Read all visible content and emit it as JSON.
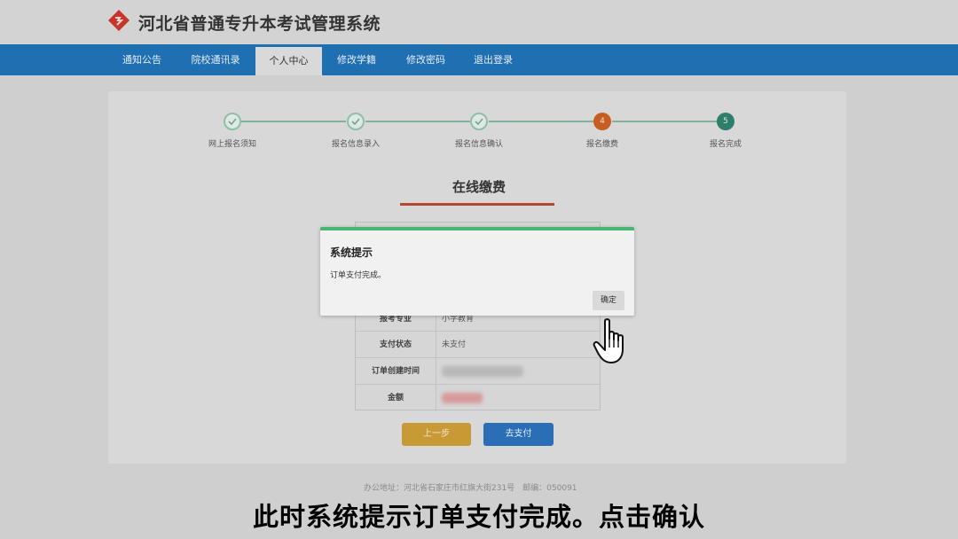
{
  "header": {
    "title": "河北省普通专升本考试管理系统",
    "logo_icon": "brand-logo-icon"
  },
  "nav": {
    "items": [
      {
        "label": "通知公告"
      },
      {
        "label": "院校通讯录"
      },
      {
        "label": "个人中心"
      },
      {
        "label": "修改学籍"
      },
      {
        "label": "修改密码"
      },
      {
        "label": "退出登录"
      }
    ],
    "active": "个人中心"
  },
  "steps": [
    {
      "label": "网上报名须知",
      "state": "done"
    },
    {
      "label": "报名信息录入",
      "state": "done"
    },
    {
      "label": "报名信息确认",
      "state": "done"
    },
    {
      "label": "报名缴费",
      "state": "current",
      "number": "4"
    },
    {
      "label": "报名完成",
      "state": "todo",
      "number": "5"
    }
  ],
  "section": {
    "title": "在线缴费"
  },
  "order_table": {
    "rows": [
      {
        "key": "报考专业",
        "value": "小学教育"
      },
      {
        "key": "支付状态",
        "value": "未支付"
      },
      {
        "key": "订单创建时间",
        "value": ""
      },
      {
        "key": "金额",
        "value": ""
      }
    ]
  },
  "buttons": {
    "prev": "上一步",
    "pay": "去支付"
  },
  "footer": {
    "text": "办公地址：河北省石家庄市红旗大街231号　邮编：050091"
  },
  "dialog": {
    "title": "系统提示",
    "message": "订单支付完成。",
    "ok": "确定"
  },
  "caption": {
    "text": "此时系统提示订单支付完成。点击确认"
  },
  "colors": {
    "nav_blue": "#1f6fb3",
    "step_current": "#c65e22",
    "step_todo": "#2f7d6b",
    "dialog_accent": "#49b674",
    "underline": "#b4482f"
  }
}
